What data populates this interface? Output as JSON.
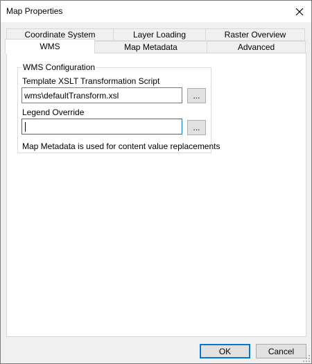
{
  "window": {
    "title": "Map Properties",
    "close_icon": "close-icon"
  },
  "tabs": {
    "row1": [
      {
        "label": "Coordinate System"
      },
      {
        "label": "Layer Loading"
      },
      {
        "label": "Raster Overview"
      }
    ],
    "row2": [
      {
        "label": "WMS",
        "active": true
      },
      {
        "label": "Map Metadata"
      },
      {
        "label": "Advanced"
      }
    ]
  },
  "wms": {
    "group_title": "WMS Configuration",
    "template_label": "Template XSLT Transformation Script",
    "template_value": "wms\\defaultTransform.xsl",
    "browse_label": "...",
    "legend_label": "Legend Override",
    "legend_value": "",
    "note": "Map Metadata is used for content value replacements"
  },
  "buttons": {
    "ok": "OK",
    "cancel": "Cancel"
  },
  "colors": {
    "accent": "#0078d7",
    "window_bg": "#f0f0f0",
    "panel_bg": "#ffffff"
  }
}
